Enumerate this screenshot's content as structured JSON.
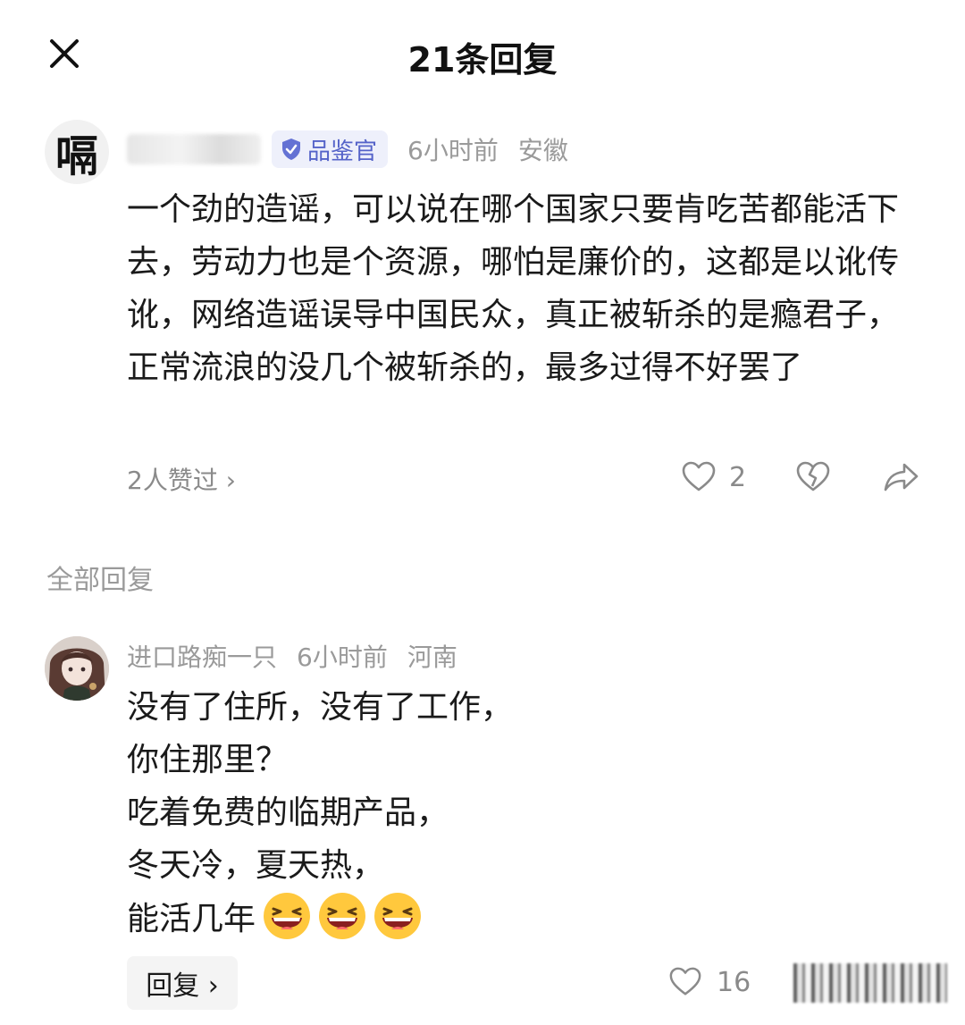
{
  "header": {
    "title": "21条回复",
    "close_icon": "close-icon"
  },
  "main_comment": {
    "avatar_glyph": "嗝",
    "badge": "品鉴官",
    "time": "6小时前",
    "location": "安徽",
    "text": "一个劲的造谣，可以说在哪个国家只要肯吃苦都能活下去，劳动力也是个资源，哪怕是廉价的，这都是以讹传讹，网络造谣误导中国民众，真正被斩杀的是瘾君子，正常流浪的没几个被斩杀的，最多过得不好罢了",
    "likers": "2人赞过 ›",
    "like_count": "2",
    "icons": [
      "heart-icon",
      "broken-heart-icon",
      "share-icon"
    ]
  },
  "section_title": "全部回复",
  "reply": {
    "author": "进口路痴一只",
    "time": "6小时前",
    "location": "河南",
    "lines": [
      "没有了住所，没有了工作，",
      "你住那里？",
      "吃着免费的临期产品，",
      "冬天冷，夏天热，",
      "能活几年"
    ],
    "emoji": "laughing-emoji",
    "reply_button": "回复 ›",
    "like_count": "16"
  },
  "colors": {
    "badge_bg": "#eef0fb",
    "badge_text": "#5563c9",
    "meta_text": "#9a9a9a",
    "emoji_yellow": "#ffc83d"
  }
}
